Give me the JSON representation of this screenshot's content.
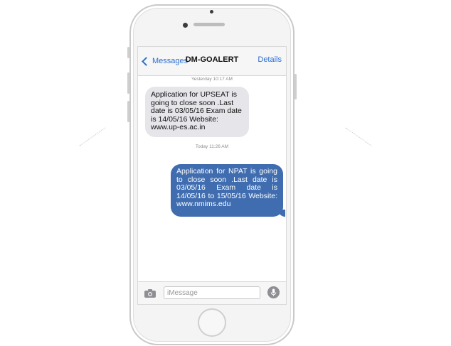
{
  "navbar": {
    "back_label": "Messages",
    "title": "DM-GOALERT",
    "details_label": "Details"
  },
  "conversation": {
    "messages": [
      {
        "timestamp": "Yesterday 10:17 AM",
        "direction": "incoming",
        "text": "Application for UPSEAT is going to close soon .Last date is 03/05/16 Exam date is 14/05/16 Website: www.up-es.ac.in"
      },
      {
        "timestamp": "Today 11:26 AM",
        "direction": "outgoing",
        "text": "Application for NPAT is going to close soon .Last date is 03/05/16 Exam date is 14/05/16 to 15/05/16 Website: www.nmims.edu"
      }
    ]
  },
  "input_bar": {
    "placeholder": "iMessage",
    "value": "",
    "camera_icon": "camera-icon",
    "mic_icon": "microphone-icon"
  },
  "colors": {
    "accent": "#2c6fd1",
    "outgoing_bubble": "#3f6db0",
    "incoming_bubble": "#e5e5ea"
  }
}
